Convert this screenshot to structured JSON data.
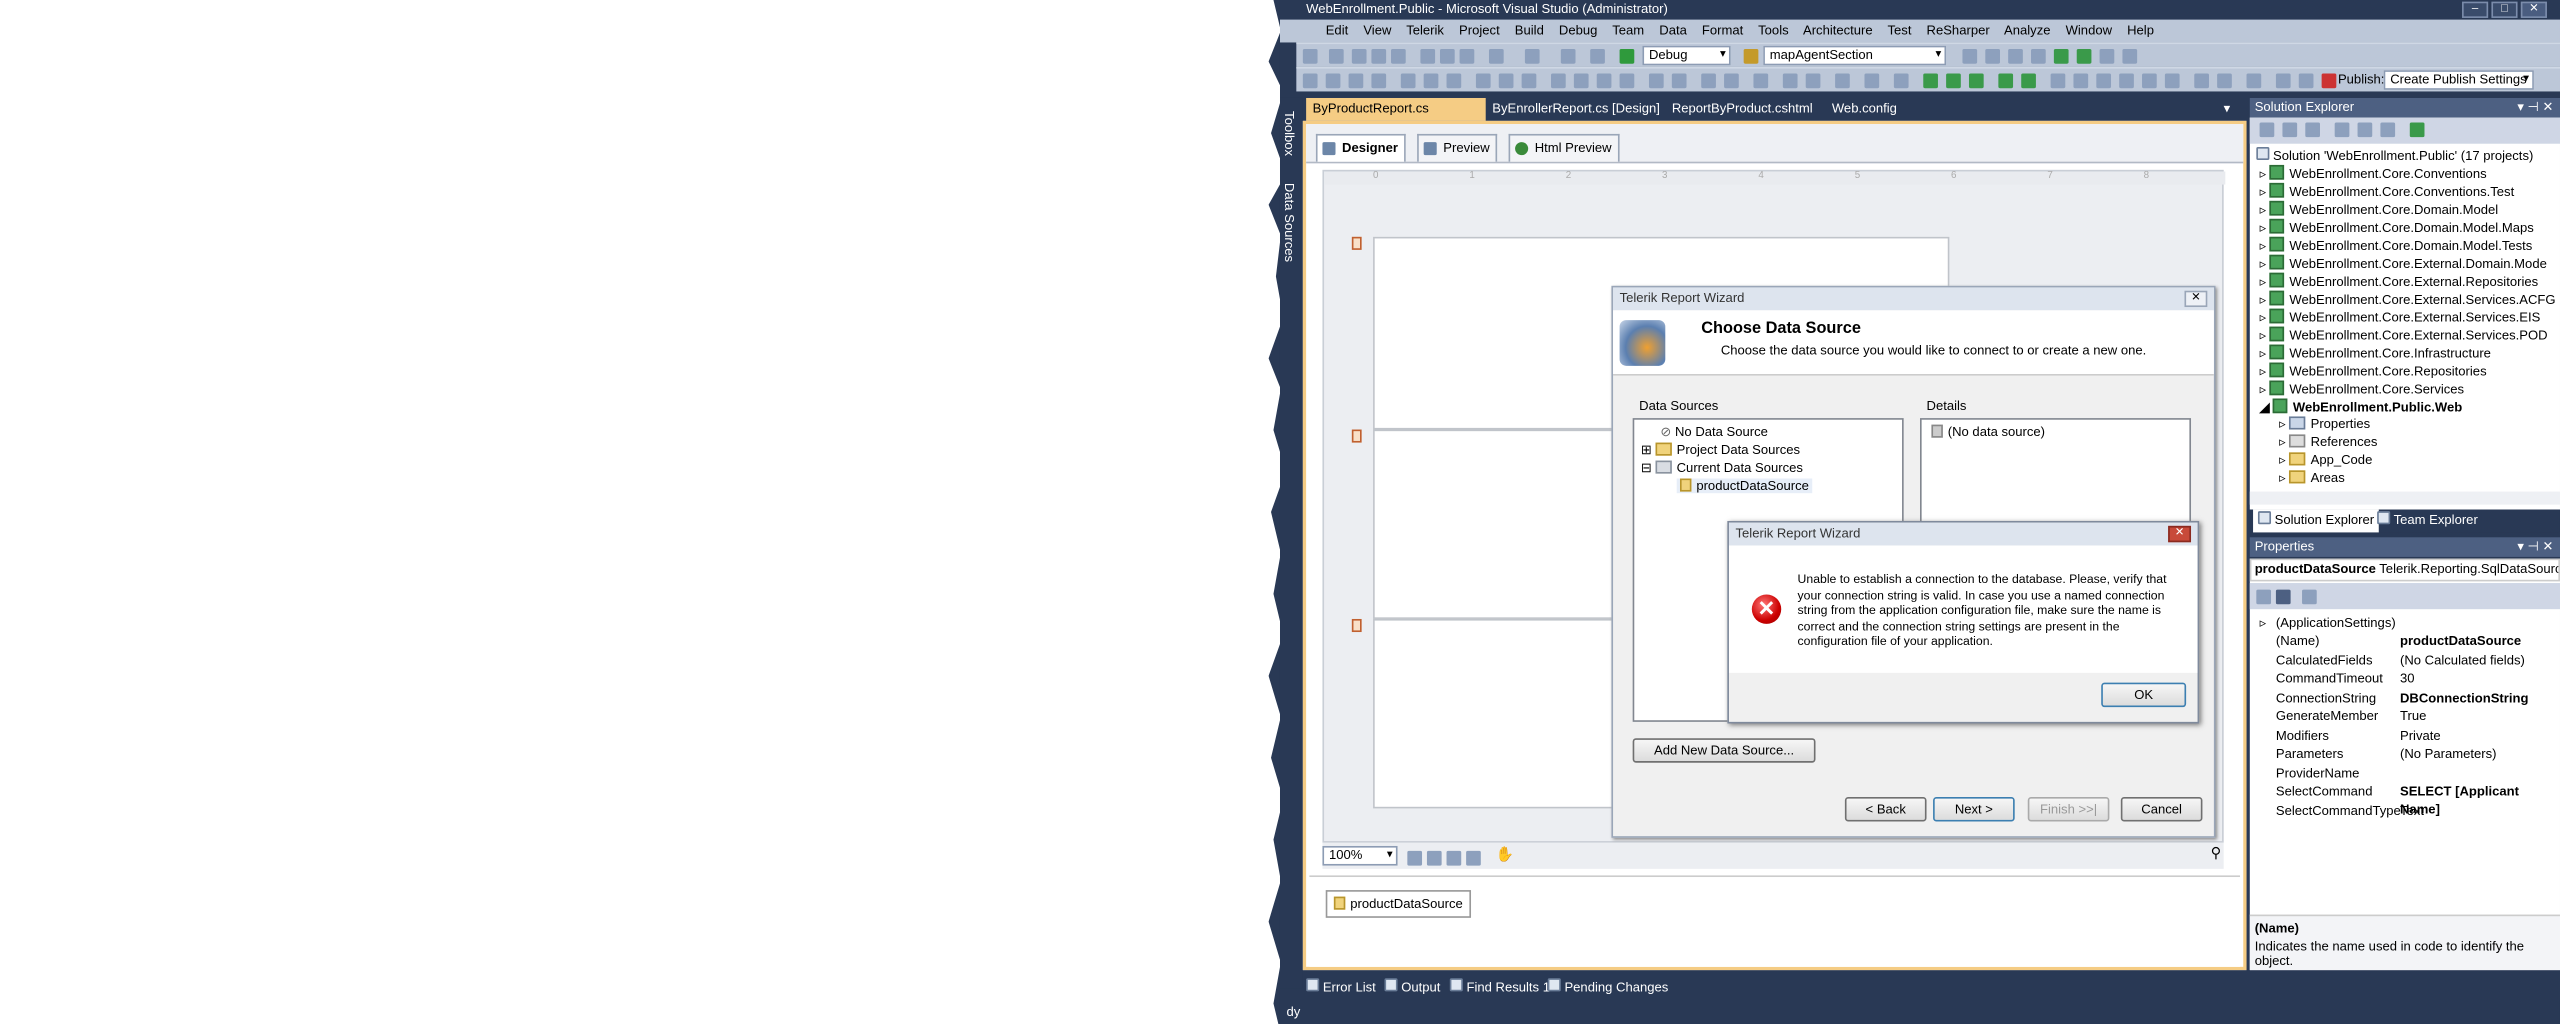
{
  "window": {
    "title": "WebEnrollment.Public - Microsoft Visual Studio (Administrator)",
    "min": "–",
    "max": "□",
    "close": "✕"
  },
  "menu": [
    "Edit",
    "View",
    "Telerik",
    "Project",
    "Build",
    "Debug",
    "Team",
    "Data",
    "Format",
    "Tools",
    "Architecture",
    "Test",
    "ReSharper",
    "Analyze",
    "Window",
    "Help"
  ],
  "toolbar": {
    "config": "Debug",
    "search": "mapAgentSection",
    "publish_label": "Publish:",
    "publish_value": "Create Publish Settings"
  },
  "left_sidebar": {
    "toolbox": "Toolbox",
    "data_sources": "Data Sources"
  },
  "doc_tabs": [
    {
      "label": "ByProductReport.cs [Design]",
      "active": true
    },
    {
      "label": "ByEnrollerReport.cs [Design]"
    },
    {
      "label": "ReportByProduct.cshtml"
    },
    {
      "label": "Web.config"
    }
  ],
  "designer_tabs": [
    "Designer",
    "Preview",
    "Html Preview"
  ],
  "ruler": [
    "0",
    "1",
    "2",
    "3",
    "4",
    "5",
    "6",
    "7",
    "8"
  ],
  "zoom": "100%",
  "tray_item": "productDataSource",
  "wizard": {
    "title": "Telerik Report Wizard",
    "heading": "Choose Data Source",
    "subheading": "Choose the data source you would like to connect to or create a new one.",
    "data_sources_label": "Data Sources",
    "details_label": "Details",
    "tree": [
      "No Data Source",
      "Project Data Sources",
      "Current Data Sources",
      "productDataSource"
    ],
    "details": "(No data source)",
    "add_button": "Add New Data Source...",
    "back": "< Back",
    "next": "Next >",
    "finish": "Finish >>|",
    "cancel": "Cancel"
  },
  "error": {
    "title": "Telerik Report Wizard",
    "message": "Unable to establish a connection to the database. Please, verify that your connection string is valid. In case you use a named connection string from the application configuration file, make sure the name is correct and the connection string settings are present in the configuration file of your application.",
    "ok": "OK"
  },
  "bottom_tabs": [
    "Error List",
    "Output",
    "Find Results 1",
    "Pending Changes"
  ],
  "status": "dy",
  "solution_explorer": {
    "title": "Solution Explorer",
    "items": [
      "Solution 'WebEnrollment.Public' (17 projects)",
      "WebEnrollment.Core.Conventions",
      "WebEnrollment.Core.Conventions.Test",
      "WebEnrollment.Core.Domain.Model",
      "WebEnrollment.Core.Domain.Model.Maps",
      "WebEnrollment.Core.Domain.Model.Tests",
      "WebEnrollment.Core.External.Domain.Mode",
      "WebEnrollment.Core.External.Repositories",
      "WebEnrollment.Core.External.Services.ACFG",
      "WebEnrollment.Core.External.Services.EIS",
      "WebEnrollment.Core.External.Services.POD",
      "WebEnrollment.Core.Infrastructure",
      "WebEnrollment.Core.Repositories",
      "WebEnrollment.Core.Services",
      "WebEnrollment.Public.Web",
      "Properties",
      "References",
      "App_Code",
      "Areas"
    ],
    "tabs": [
      "Solution Explorer",
      "Team Explorer"
    ]
  },
  "properties": {
    "title": "Properties",
    "object_name": "productDataSource",
    "object_type": "Telerik.Reporting.SqlDataSource",
    "group": "(ApplicationSettings)",
    "rows": [
      {
        "name": "(Name)",
        "value": "productDataSource",
        "bold": true
      },
      {
        "name": "CalculatedFields",
        "value": "(No Calculated fields)"
      },
      {
        "name": "CommandTimeout",
        "value": "30"
      },
      {
        "name": "ConnectionString",
        "value": "DBConnectionString",
        "bold": true
      },
      {
        "name": "GenerateMember",
        "value": "True"
      },
      {
        "name": "Modifiers",
        "value": "Private"
      },
      {
        "name": "Parameters",
        "value": "(No Parameters)"
      },
      {
        "name": "ProviderName",
        "value": ""
      },
      {
        "name": "SelectCommand",
        "value": "SELECT [Applicant Name]",
        "bold": true
      },
      {
        "name": "SelectCommandType",
        "value": "Text"
      }
    ],
    "desc_title": "(Name)",
    "desc_text": "Indicates the name used in code to identify the object."
  },
  "colors": {
    "chrome": "#293955",
    "active_tab": "#f5cc84",
    "toolbar": "#bcc7d8"
  }
}
